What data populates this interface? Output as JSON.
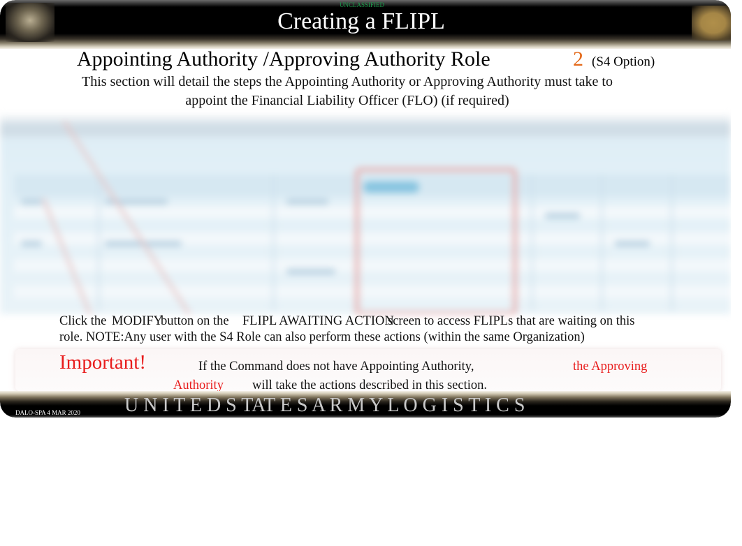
{
  "header": {
    "classification": "UNCLASSIFIED",
    "title": "Creating a FLIPL"
  },
  "section": {
    "title": "Appointing Authority /Approving Authority Role",
    "step_number": "2",
    "step_option": "(S4 Option)",
    "intro_line1": "This section will detail the steps the Appointing Authority or Approving Authority must take to",
    "intro_line2": "appoint the Financial Liability Officer (FLO) (if required)"
  },
  "screenshot": {
    "description": "blurred FLIPL Awaiting Action table screenshot with highlighted MODIFY column"
  },
  "instructions": {
    "seg1": "Click the",
    "seg2": "MODIFY",
    "seg3": "button on the",
    "seg4": "FLIPL AWAITING ACTION",
    "seg5": "screen to access FLIPLs that are waiting on this",
    "line2": "role.  NOTE:Any user with the S4 Role can also perform these actions (within the same Organization)"
  },
  "important": {
    "label": "Important!",
    "text1": "If the Command does not have Appointing Authority,",
    "red1": "the Approving",
    "red2": "Authority",
    "text2": "will take the actions described in this section."
  },
  "footer": {
    "date": "DALO-SPA 4 MAR 2020",
    "brand": "U N I T E D S TAT E S A R M Y L O G I S T I C S"
  },
  "colors": {
    "accent_orange": "#e46a1b",
    "important_red": "#e81c1c",
    "classification_green": "#1a9a4a"
  }
}
